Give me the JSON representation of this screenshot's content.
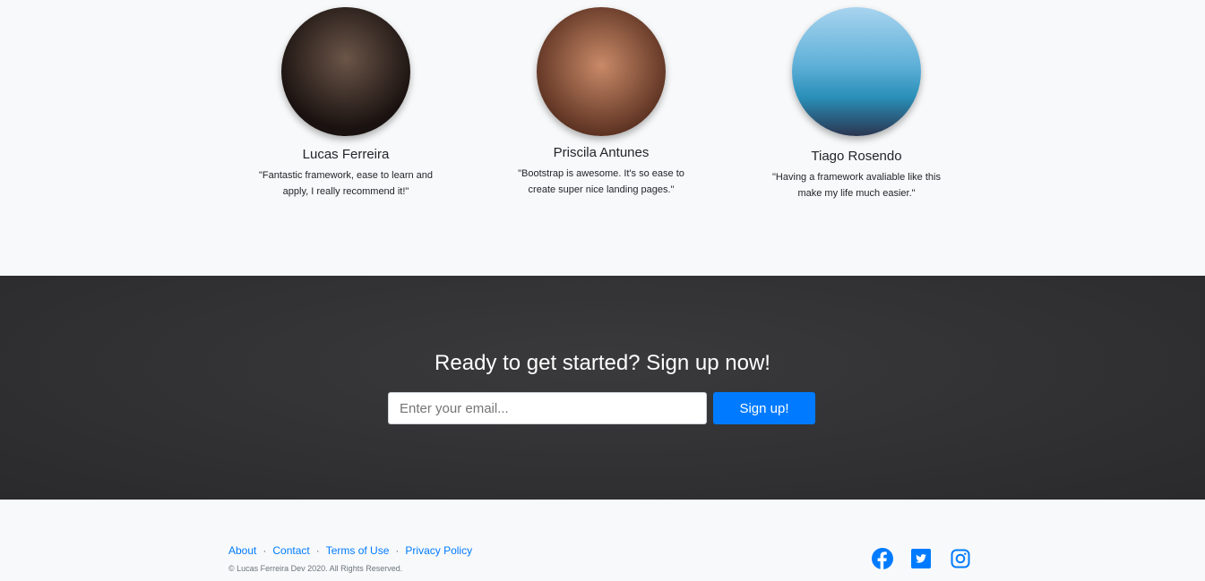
{
  "testimonials": [
    {
      "name": "Lucas Ferreira",
      "quote": "\"Fantastic framework, ease to learn and apply, I really recommend it!\""
    },
    {
      "name": "Priscila Antunes",
      "quote": "\"Bootstrap is awesome. It's so ease to create super nice landing pages.\""
    },
    {
      "name": "Tiago Rosendo",
      "quote": "\"Having a framework avaliable like this make my life much easier.\""
    }
  ],
  "cta": {
    "heading": "Ready to get started? Sign up now!",
    "email_placeholder": "Enter your email...",
    "button": "Sign up!"
  },
  "footer": {
    "links": [
      "About",
      "Contact",
      "Terms of Use",
      "Privacy Policy"
    ],
    "separator": "·",
    "copyright": "© Lucas Ferreira Dev 2020. All Rights Reserved.",
    "social": [
      "facebook-icon",
      "twitter-icon",
      "instagram-icon"
    ]
  },
  "colors": {
    "accent": "#007bff"
  }
}
